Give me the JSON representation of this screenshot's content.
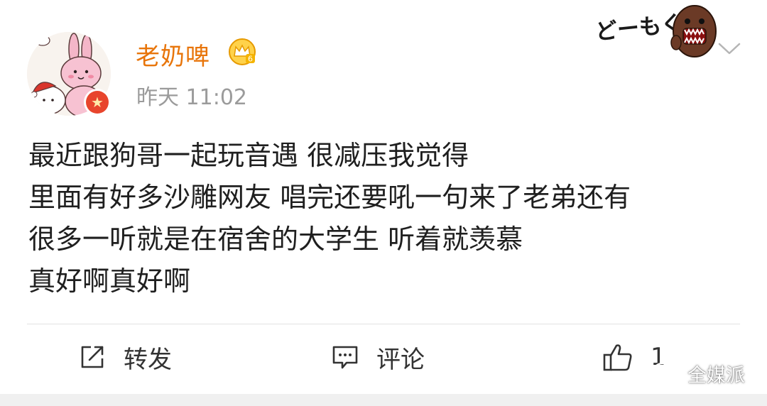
{
  "post": {
    "author": {
      "name": "老奶啤",
      "vip_level": "6",
      "avatar_icon": "bunny-cartoon-avatar",
      "verified_icon": "star-verified-icon"
    },
    "timestamp": "昨天 11:02",
    "sticker_text": "どーもくん",
    "body_lines": [
      "最近跟狗哥一起玩音遇 很减压我觉得",
      "里面有好多沙雕网友 唱完还要吼一句来了老弟还有",
      "很多一听就是在宿舍的大学生 听着就羡慕",
      "真好啊真好啊"
    ],
    "actions": {
      "repost_label": "转发",
      "comment_label": "评论",
      "like_count": "1"
    }
  },
  "watermark": {
    "text": "全媒派"
  },
  "colors": {
    "username": "#e8750a",
    "timestamp": "#9b9b9b",
    "body_text": "#1f1f1f",
    "verified": "#e8452c",
    "vip_gold": "#f5b400"
  }
}
